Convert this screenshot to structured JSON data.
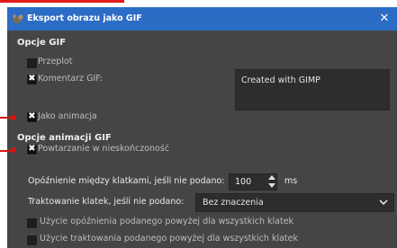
{
  "dialog": {
    "title": "Eksport obrazu jako GIF",
    "close": "✕"
  },
  "gif_options": {
    "heading": "Opcje GIF",
    "interlace_label": "Przeplot",
    "interlace_checked": false,
    "comment_label": "Komentarz GIF:",
    "comment_checked": true,
    "comment_value": "Created with GIMP"
  },
  "as_animation": {
    "label": "Jako animacja",
    "checked": true
  },
  "animation_options": {
    "heading": "Opcje animacji GIF",
    "loop_label": "Powtarzanie w nieskończoność",
    "loop_checked": true,
    "delay_label": "Opóźnienie między klatkami, jeśli nie podano:",
    "delay_value": "100",
    "delay_unit": "ms",
    "disposal_label": "Traktowanie klatek, jeśli nie podano:",
    "disposal_value": "Bez znaczenia",
    "use_delay_all_label": "Użycie opóźnienia podanego powyżej dla wszystkich klatek",
    "use_delay_all_checked": false,
    "use_disposal_all_label": "Użycie traktowania podanego powyżej dla wszystkich klatek",
    "use_disposal_all_checked": false
  },
  "colors": {
    "titlebar": "#2b6cc5",
    "dialog_bg": "#454545",
    "annotation": "#d51515"
  }
}
